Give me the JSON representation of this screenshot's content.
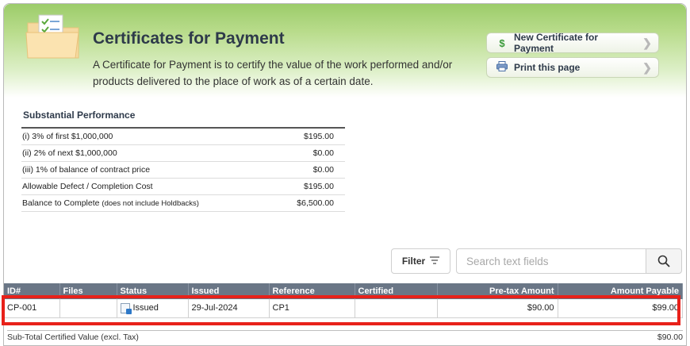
{
  "header": {
    "title": "Certificates for Payment",
    "description": "A Certificate for Payment is to certify the value of the work performed and/or products delivered to the place of work as of a certain date.",
    "buttons": [
      {
        "label": "New Certificate for Payment",
        "icon": "dollar-icon"
      },
      {
        "label": "Print this page",
        "icon": "printer-icon"
      }
    ]
  },
  "substantial_performance": {
    "title": "Substantial Performance",
    "rows": [
      {
        "label": "(i) 3% of first $1,000,000",
        "note": "",
        "value": "$195.00"
      },
      {
        "label": "(ii) 2% of next $1,000,000",
        "note": "",
        "value": "$0.00"
      },
      {
        "label": "(iii) 1% of balance of contract price",
        "note": "",
        "value": "$0.00"
      },
      {
        "label": "Allowable Defect / Completion Cost",
        "note": "",
        "value": "$195.00"
      },
      {
        "label": "Balance to Complete",
        "note": "(does not include Holdbacks)",
        "value": "$6,500.00"
      }
    ]
  },
  "toolbar": {
    "filter_label": "Filter",
    "search_placeholder": "Search text fields"
  },
  "table": {
    "columns": [
      "ID#",
      "Files",
      "Status",
      "Issued",
      "Reference",
      "Certified",
      "Pre-tax Amount",
      "Amount Payable"
    ],
    "rows": [
      {
        "id": "CP-001",
        "files": "",
        "status": "Issued",
        "issued": "29-Jul-2024",
        "reference": "CP1",
        "certified": "",
        "pretax": "$90.00",
        "payable": "$99.00"
      }
    ]
  },
  "subtotal": {
    "label": "Sub-Total Certified Value (excl. Tax)",
    "value": "$90.00"
  },
  "colors": {
    "header_green": "#9ccc6a",
    "table_header": "#6a7686",
    "highlight": "#e8211a",
    "dollar_green": "#3b9a3b"
  }
}
